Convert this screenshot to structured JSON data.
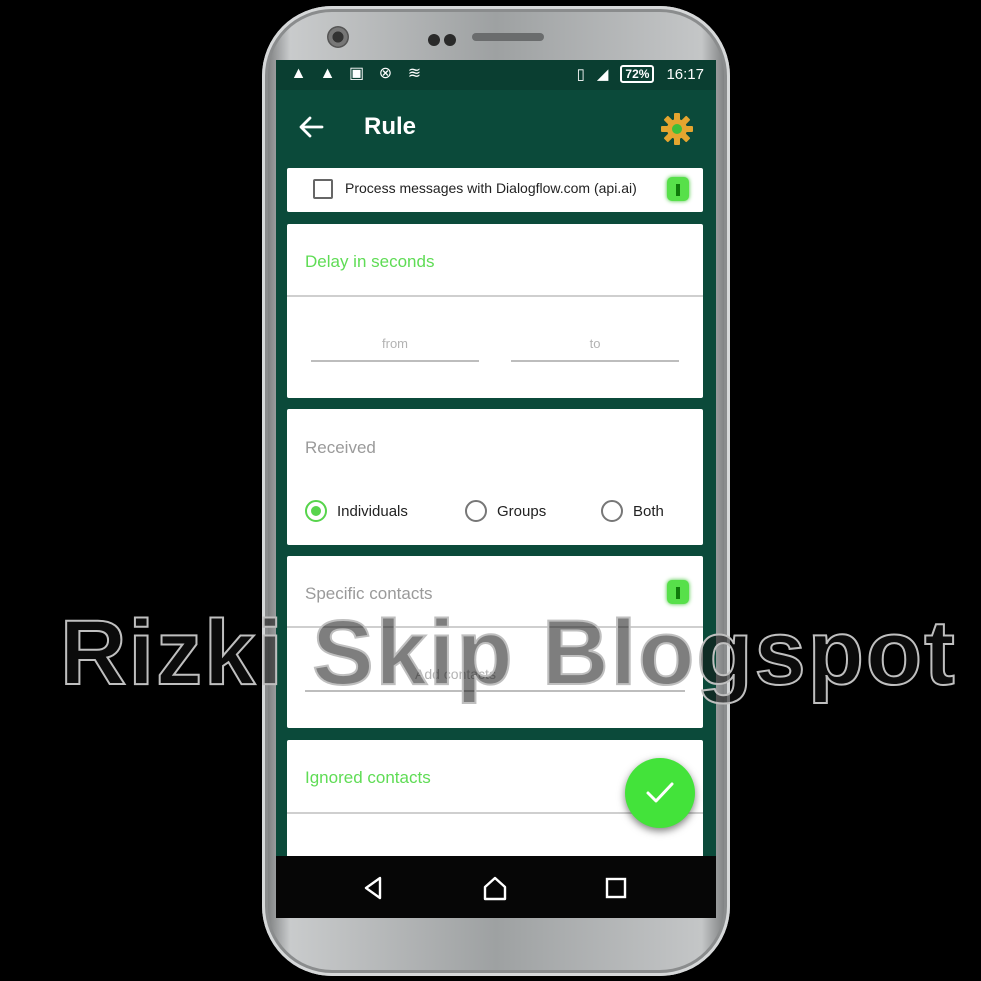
{
  "status_bar": {
    "battery": "72%",
    "time": "16:17",
    "left_icons": [
      "warning-icon",
      "warning-icon",
      "image-icon",
      "data-saver-icon",
      "signal-icon"
    ]
  },
  "toolbar": {
    "title": "Rule"
  },
  "dialogflow": {
    "label": "Process messages with Dialogflow.com (api.ai)",
    "checked": false
  },
  "delay": {
    "title": "Delay in seconds",
    "min_placeholder": "from",
    "max_placeholder": "to"
  },
  "received": {
    "title": "Received",
    "options": [
      {
        "label": "Individuals",
        "selected": true
      },
      {
        "label": "Groups",
        "selected": false
      },
      {
        "label": "Both",
        "selected": false
      }
    ]
  },
  "specific_contacts": {
    "title": "Specific contacts",
    "placeholder": "Add contacts"
  },
  "ignored_contacts": {
    "title": "Ignored contacts"
  },
  "watermark": {
    "text": "Rizki Skip Blogspot"
  },
  "colors": {
    "primary_dark": "#0a3e31",
    "primary": "#0b4a3a",
    "accent": "#43e33a"
  }
}
